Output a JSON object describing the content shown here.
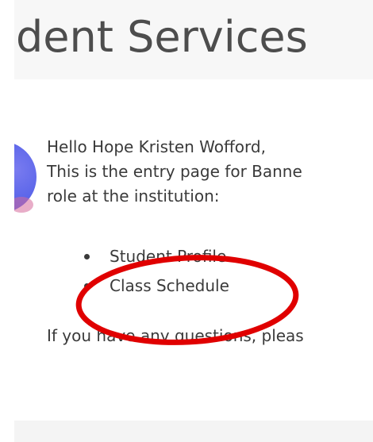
{
  "header": {
    "title": "dent Services"
  },
  "welcome": {
    "greeting": "Hello Hope Kristen Wofford,",
    "line2": "This is the entry page for Banne",
    "line3": "role at the institution:"
  },
  "links": [
    {
      "label": "Student Profile"
    },
    {
      "label": "Class Schedule"
    }
  ],
  "questions_text": "If you have any questions, pleas",
  "colors": {
    "annotation": "#e00000",
    "avatar": "#5561e8",
    "header_bg": "#f7f7f7"
  },
  "icons": {
    "avatar": "user-avatar-icon",
    "bullet": "bullet-dot-icon",
    "annotation": "red-ellipse-annotation"
  }
}
